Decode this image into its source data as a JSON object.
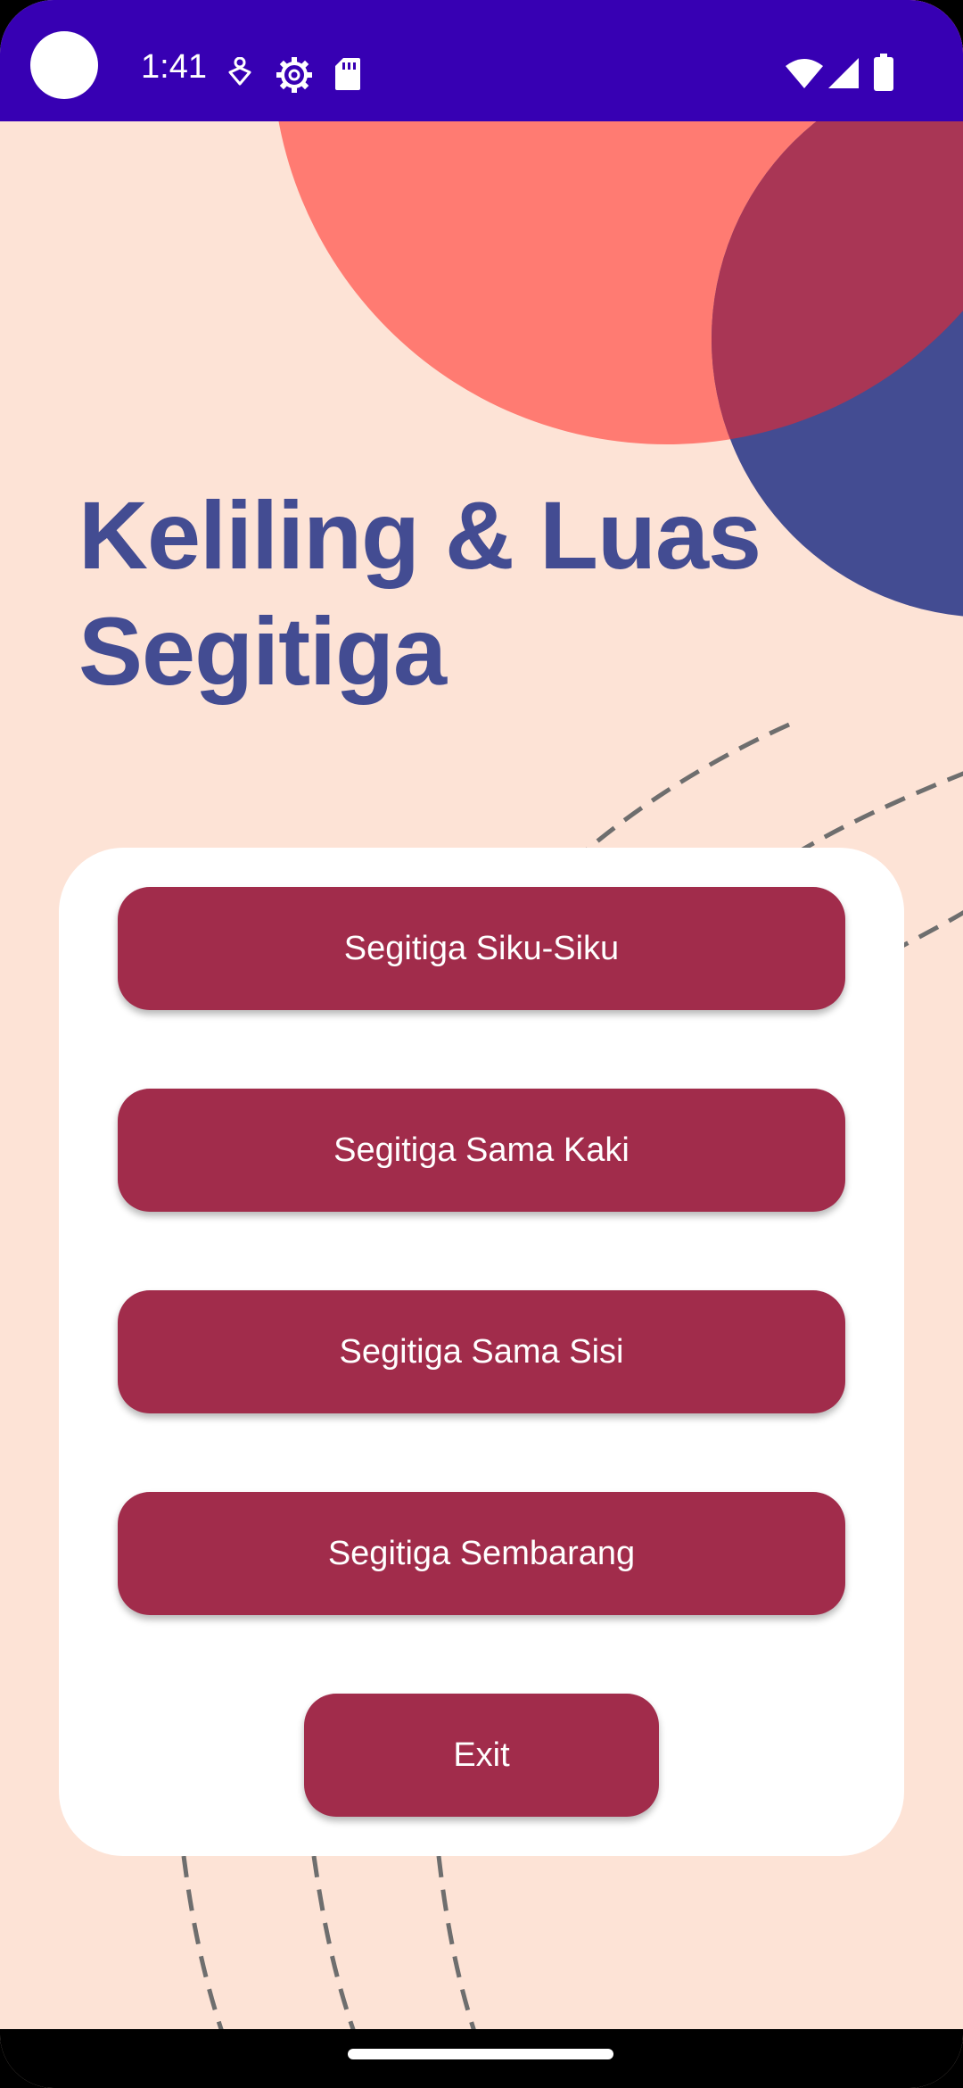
{
  "status_bar": {
    "time": "1:41",
    "background_color": "#3700B3",
    "left_icons": [
      "notification-dot",
      "accessibility-icon",
      "settings-icon",
      "sd-card-icon"
    ],
    "right_icons": [
      "wifi-icon",
      "cellular-signal-icon",
      "battery-icon"
    ]
  },
  "title": {
    "line1": "Keliling & Luas",
    "line2": "Segitiga",
    "color": "#434C92"
  },
  "menu": {
    "buttons": [
      {
        "label": "Segitiga Siku-Siku"
      },
      {
        "label": "Segitiga Sama Kaki"
      },
      {
        "label": "Segitiga Sama Sisi"
      },
      {
        "label": "Segitiga Sembarang"
      }
    ],
    "exit_label": "Exit",
    "button_color": "#A12C4B"
  },
  "theme": {
    "background": "#FDE3D6",
    "circle_coral": "#FF7B72",
    "circle_navy": "#434C92",
    "circle_overlap": "#A93655"
  }
}
